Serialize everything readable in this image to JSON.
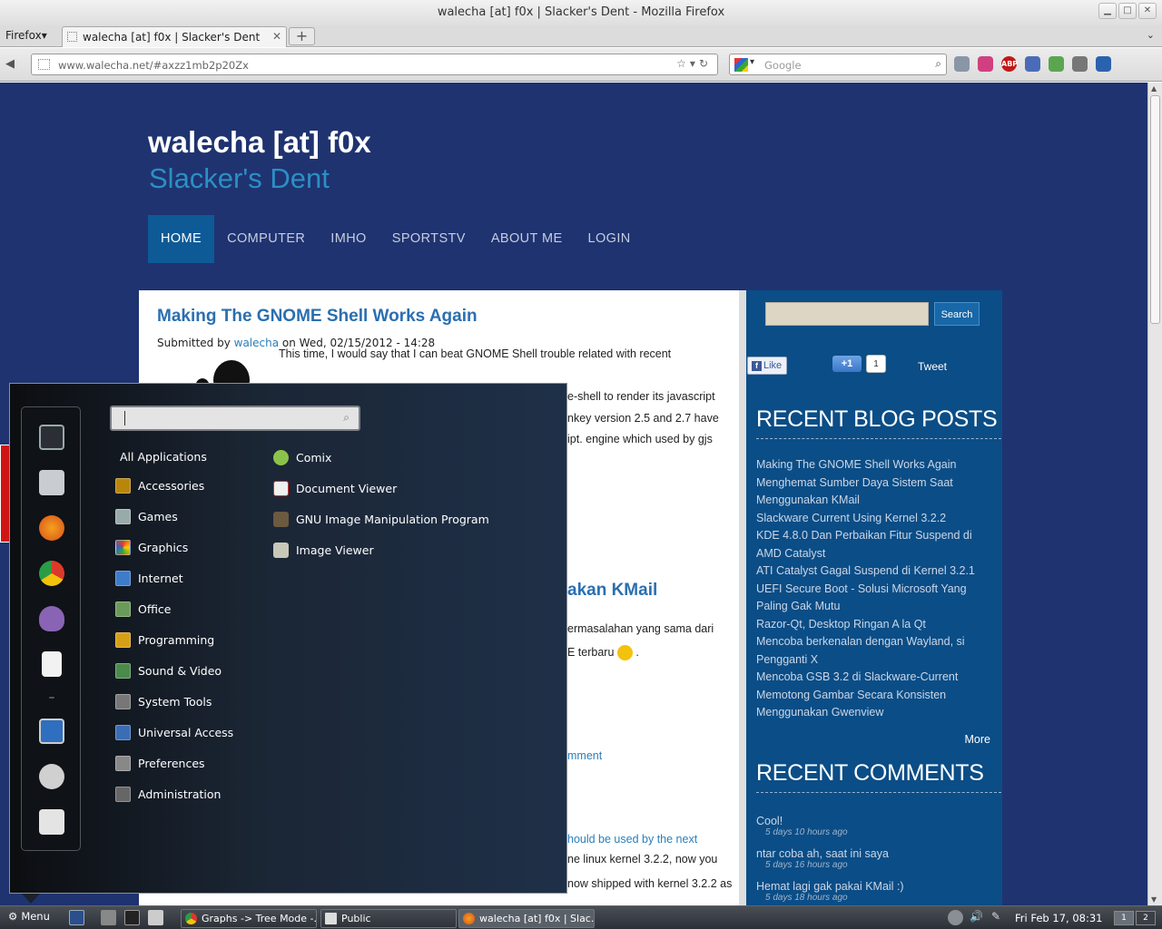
{
  "window": {
    "title": "walecha [at] f0x | Slacker's Dent - Mozilla Firefox"
  },
  "browser": {
    "menu_label": "Firefox",
    "tab_title": "walecha [at] f0x | Slacker's Dent",
    "new_tab_label": "+",
    "url": "www.walecha.net/#axzz1mb2p20Zx",
    "search_placeholder": "Google",
    "addon_badge": "ABP"
  },
  "site": {
    "title": "walecha [at] f0x",
    "slogan": "Slacker's Dent",
    "nav": [
      "HOME",
      "COMPUTER",
      "IMHO",
      "SPORTSTV",
      "ABOUT ME",
      "LOGIN"
    ],
    "active_nav": "HOME"
  },
  "article1": {
    "title": "Making The GNOME Shell Works Again",
    "meta_prefix": "Submitted by",
    "author": "walecha",
    "meta_date": "on Wed, 02/15/2012 - 14:28",
    "lines": [
      "This time, I would say that I can beat GNOME Shell trouble related with recent",
      "e-shell to render its javascript",
      "nkey version 2.5 and 2.7 have",
      "ipt. engine which used by gjs"
    ]
  },
  "article2": {
    "title_fragment": "akan KMail",
    "lines": [
      "ermasalahan yang sama dari",
      "E terbaru"
    ],
    "comment_link": "mment"
  },
  "article3": {
    "link_fragment": "hould be used by the next",
    "line1": "ne linux kernel 3.2.2, now you",
    "line2": "now shipped with kernel 3.2.2 as"
  },
  "sidebar": {
    "search_button": "Search",
    "like_label": "Like",
    "plusone_label": "+1",
    "plusone_count": "1",
    "tweet_label": "Tweet",
    "recent_posts_heading": "RECENT BLOG POSTS",
    "recent_posts": [
      "Making The GNOME Shell Works Again",
      "Menghemat Sumber Daya Sistem Saat Menggunakan KMail",
      "Slackware Current Using Kernel 3.2.2",
      "KDE 4.8.0 Dan Perbaikan Fitur Suspend di AMD Catalyst",
      "ATI Catalyst Gagal Suspend di Kernel 3.2.1",
      "UEFI Secure Boot - Solusi Microsoft Yang Paling Gak Mutu",
      "Razor-Qt, Desktop Ringan A la Qt",
      "Mencoba berkenalan dengan Wayland, si Pengganti X",
      "Mencoba GSB 3.2 di Slackware-Current",
      "Memotong Gambar Secara Konsisten Menggunakan Gwenview"
    ],
    "more_label": "More",
    "recent_comments_heading": "RECENT COMMENTS",
    "comments": [
      {
        "text": "Cool!",
        "age": "5 days 10 hours ago"
      },
      {
        "text": "ntar coba ah, saat ini saya",
        "age": "5 days 16 hours ago"
      },
      {
        "text": "Hemat lagi gak pakai KMail :)",
        "age": "5 days 18 hours ago"
      }
    ]
  },
  "app_menu": {
    "search_placeholder": "",
    "categories": [
      "All Applications",
      "Accessories",
      "Games",
      "Graphics",
      "Internet",
      "Office",
      "Programming",
      "Sound & Video",
      "System Tools",
      "Universal Access",
      "Preferences",
      "Administration"
    ],
    "apps": [
      "Comix",
      "Document Viewer",
      "GNU Image Manipulation Program",
      "Image Viewer"
    ],
    "favorites": [
      "terminal-icon",
      "file-manager-icon",
      "firefox-icon",
      "chrome-icon",
      "pidgin-icon",
      "text-editor-icon",
      "display-icon",
      "logout-icon",
      "power-icon"
    ]
  },
  "taskbar": {
    "menu_label": "Menu",
    "windows": [
      "Graphs -> Tree Mode -...",
      "Public",
      "walecha [at] f0x | Slac..."
    ],
    "clock": "Fri Feb 17, 08:31",
    "workspaces": [
      "1",
      "2"
    ]
  },
  "colors": {
    "page_bg": "#1f3370",
    "sidebar_bg": "#0b4d86",
    "nav_active": "#0e5a96",
    "accent_title": "#2a6fb0",
    "slogan": "#2c8fc4"
  }
}
